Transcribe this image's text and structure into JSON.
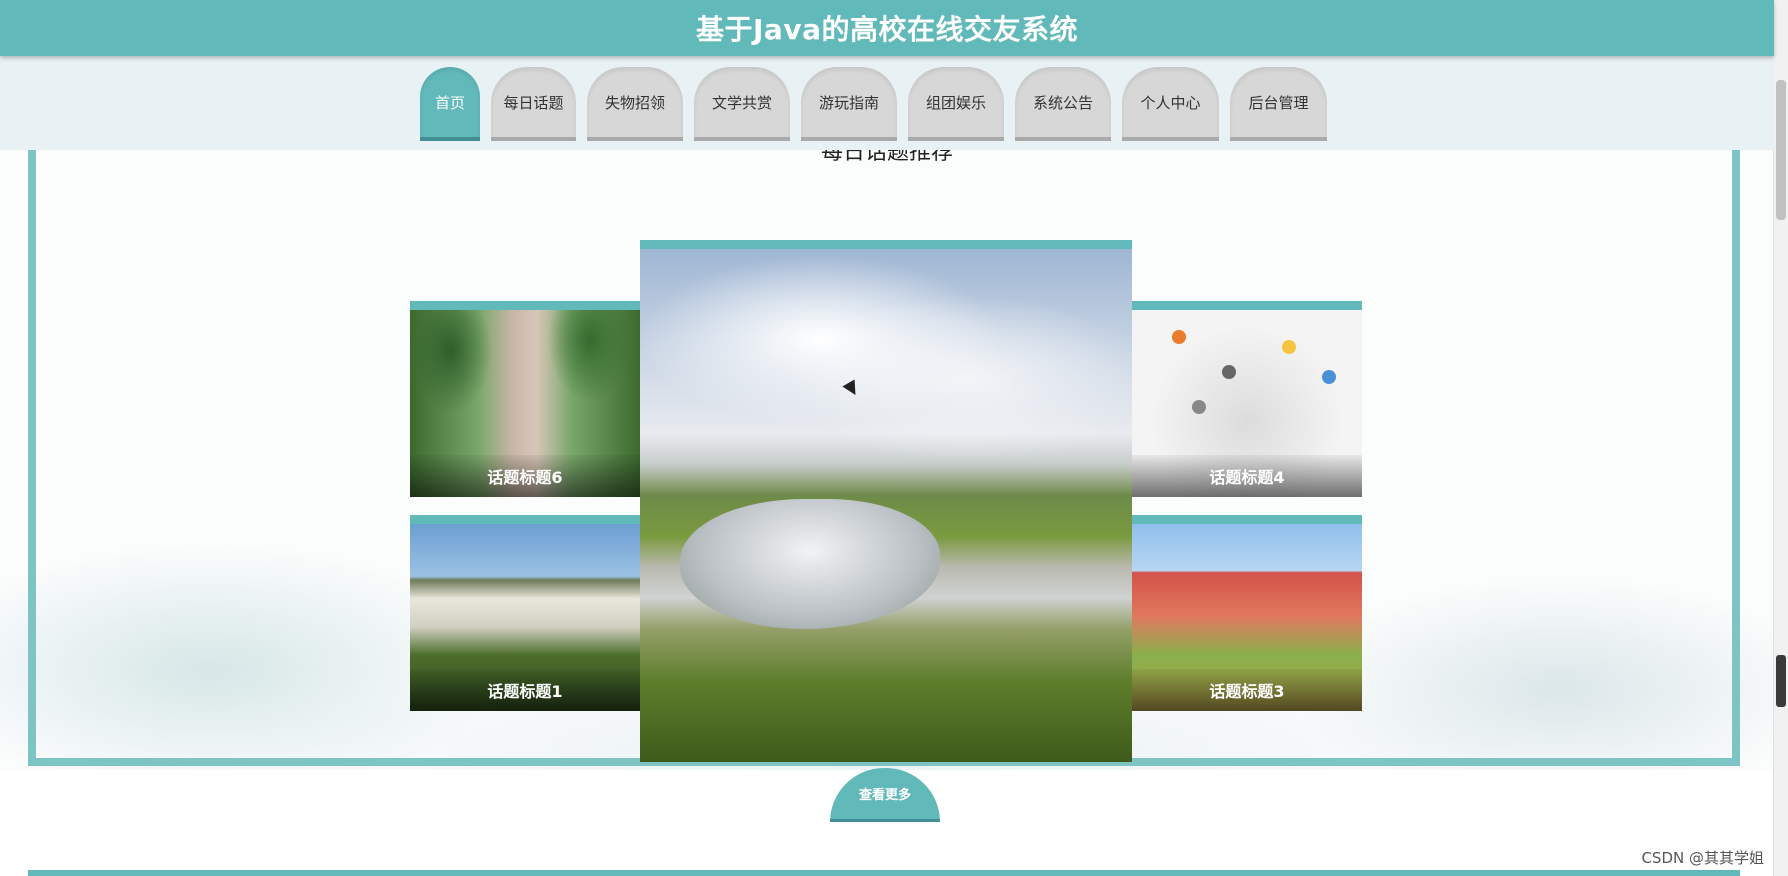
{
  "header": {
    "title": "基于Java的高校在线交友系统"
  },
  "nav": {
    "items": [
      {
        "label": "首页",
        "active": true
      },
      {
        "label": "每日话题",
        "active": false
      },
      {
        "label": "失物招领",
        "active": false
      },
      {
        "label": "文学共赏",
        "active": false
      },
      {
        "label": "游玩指南",
        "active": false
      },
      {
        "label": "组团娱乐",
        "active": false
      },
      {
        "label": "系统公告",
        "active": false
      },
      {
        "label": "个人中心",
        "active": false
      },
      {
        "label": "后台管理",
        "active": false
      }
    ]
  },
  "section": {
    "title": "每日话题推荐"
  },
  "cards": {
    "top_left": {
      "caption": "话题标题6"
    },
    "bottom_left": {
      "caption": "话题标题1"
    },
    "top_right": {
      "caption": "话题标题4"
    },
    "bottom_right": {
      "caption": "话题标题3"
    },
    "center": {
      "caption": ""
    }
  },
  "more_button": {
    "label": "查看更多"
  },
  "watermark": {
    "text": "CSDN @其其学姐"
  },
  "colors": {
    "accent": "#62b9b9",
    "nav_inactive": "#d7d7d7",
    "nav_bg": "#e8f1f4"
  }
}
